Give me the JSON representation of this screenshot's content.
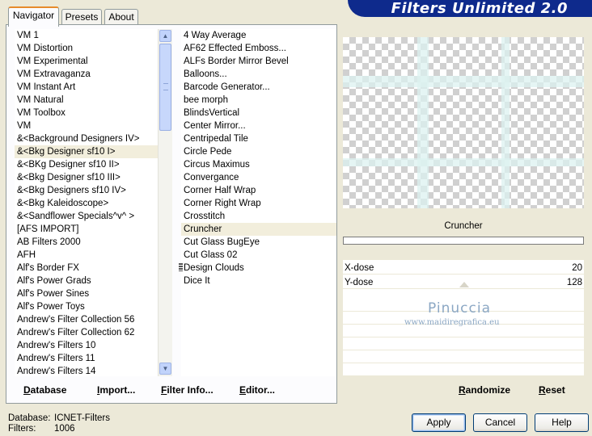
{
  "header": {
    "title": "Filters Unlimited 2.0"
  },
  "tabs": [
    {
      "label": "Navigator",
      "active": true
    },
    {
      "label": "Presets",
      "active": false
    },
    {
      "label": "About",
      "active": false
    }
  ],
  "categories": [
    "VM 1",
    "VM Distortion",
    "VM Experimental",
    "VM Extravaganza",
    "VM Instant Art",
    "VM Natural",
    "VM Toolbox",
    "VM",
    "&<Background Designers IV>",
    "&<Bkg Designer sf10 I>",
    "&<BKg Designer sf10 II>",
    "&<Bkg Designer sf10 III>",
    "&<Bkg Designers sf10 IV>",
    "&<Bkg Kaleidoscope>",
    "&<Sandflower Specials^v^ >",
    "[AFS IMPORT]",
    "AB Filters 2000",
    "AFH",
    "Alf's Border FX",
    "Alf's Power Grads",
    "Alf's Power Sines",
    "Alf's Power Toys",
    "Andrew's Filter Collection 56",
    "Andrew's Filter Collection 62",
    "Andrew's Filters 10",
    "Andrew's Filters 11",
    "Andrew's Filters 14"
  ],
  "selected_category_index": 9,
  "filters": [
    "4 Way Average",
    "AF62 Effected Emboss...",
    "ALFs Border Mirror Bevel",
    "Balloons...",
    "Barcode Generator...",
    "bee morph",
    "BlindsVertical",
    "Center Mirror...",
    "Centripedal Tile",
    "Circle Pede",
    "Circus Maximus",
    "Convergance",
    "Corner Half Wrap",
    "Corner Right Wrap",
    "Crosstitch",
    "Cruncher",
    "Cut Glass  BugEye",
    "Cut Glass 02",
    "Design Clouds",
    "Dice It"
  ],
  "selected_filter_index": 15,
  "filter_name": "Cruncher",
  "params": [
    {
      "label": "X-dose",
      "value": "20"
    },
    {
      "label": "Y-dose",
      "value": "128"
    }
  ],
  "watermark": {
    "line1": "Pinuccia",
    "line2": "www.maidiregrafica.eu"
  },
  "bottom_links": {
    "database": "Database",
    "import": "Import...",
    "filter_info": "Filter Info...",
    "editor": "Editor...",
    "randomize": "Randomize",
    "reset": "Reset"
  },
  "status": {
    "database_label": "Database:",
    "database_value": "ICNET-Filters",
    "filters_label": "Filters:",
    "filters_value": "1006"
  },
  "buttons": {
    "apply": "Apply",
    "cancel": "Cancel",
    "help": "Help"
  },
  "colors": {
    "banner": "#0e2a8c",
    "tab_accent": "#e68b2c",
    "selection": "#f2eedc"
  }
}
